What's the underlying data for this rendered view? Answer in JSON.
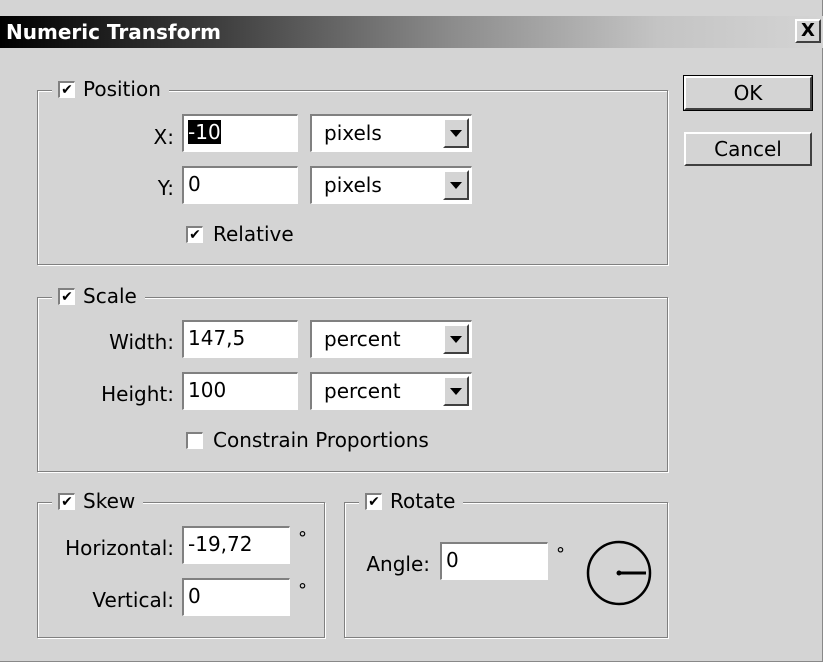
{
  "window": {
    "title": "Numeric Transform",
    "close_glyph": "X"
  },
  "buttons": {
    "ok": "OK",
    "cancel": "Cancel"
  },
  "position": {
    "title": "Position",
    "checked": true,
    "x_label": "X:",
    "x_value": "-10",
    "x_unit": "pixels",
    "y_label": "Y:",
    "y_value": "0",
    "y_unit": "pixels",
    "relative_label": "Relative",
    "relative_checked": true
  },
  "scale": {
    "title": "Scale",
    "checked": true,
    "width_label": "Width:",
    "width_value": "147,5",
    "width_unit": "percent",
    "height_label": "Height:",
    "height_value": "100",
    "height_unit": "percent",
    "constrain_label": "Constrain Proportions",
    "constrain_checked": false
  },
  "skew": {
    "title": "Skew",
    "checked": true,
    "horizontal_label": "Horizontal:",
    "horizontal_value": "-19,72",
    "vertical_label": "Vertical:",
    "vertical_value": "0",
    "degree_symbol": "°"
  },
  "rotate": {
    "title": "Rotate",
    "checked": true,
    "angle_label": "Angle:",
    "angle_value": "0",
    "degree_symbol": "°",
    "angle_dial_icon": "angle-dial-icon"
  }
}
